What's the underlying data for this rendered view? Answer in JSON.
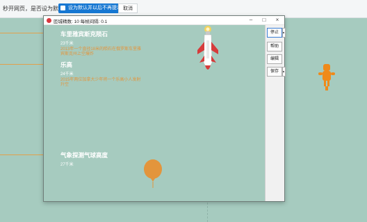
{
  "browser_bar": {
    "message": "秒开网页，是否设为默认？",
    "confirm_label": "设为默认并以后不再提示",
    "cancel_label": "取消"
  },
  "window": {
    "title": "匝城精数: 10 每帧间隔: 0.1",
    "controls": {
      "minimize": "–",
      "maximize": "□",
      "close": "×"
    }
  },
  "markers": [
    {
      "title": "车里雅宾斯克陨石",
      "altitude": "23千米",
      "description": "2013年一个直径18米的陨石在俄罗斯车里雅宾斯克州上空爆炸"
    },
    {
      "title": "乐高",
      "altitude": "24千米",
      "description": "2015年两位加拿大少年将一个乐高小人发射升空"
    },
    {
      "title": "气象探测气球高度",
      "altitude": "27千米",
      "description": ""
    }
  ],
  "side_panel": {
    "stop_label": "停止",
    "help_label": "帮助",
    "edit_label": "编辑",
    "save_label": "保存"
  },
  "colors": {
    "background": "#a6cbbf",
    "accent_orange": "#e3953c",
    "text_white": "#ffffff",
    "primary_button_border": "#3c7fd6"
  },
  "icons": {
    "rocket": "rocket-icon",
    "balloon": "weather-balloon-icon",
    "astronaut": "astronaut-icon"
  }
}
